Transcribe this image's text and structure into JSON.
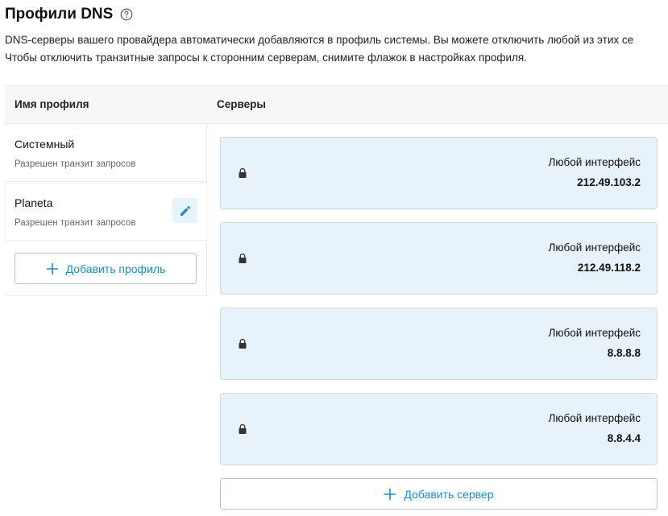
{
  "page": {
    "title": "Профили DNS",
    "description_line1": "DNS-серверы вашего провайдера автоматически добавляются в профиль системы. Вы можете отключить любой из этих се",
    "description_line2": "Чтобы отключить транзитные запросы к сторонним серверам, снимите флажок в настройках профиля."
  },
  "table": {
    "col_profile": "Имя профиля",
    "col_servers": "Серверы"
  },
  "profiles": [
    {
      "name": "Системный",
      "subtitle": "Разрешен транзит запросов"
    },
    {
      "name": "Planeta",
      "subtitle": "Разрешен транзит запросов"
    }
  ],
  "add_profile_label": "Добавить профиль",
  "servers": [
    {
      "interface": "Любой интерфейс",
      "ip": "212.49.103.2",
      "icon": "lock-icon"
    },
    {
      "interface": "Любой интерфейс",
      "ip": "212.49.118.2",
      "icon": "lock-icon"
    },
    {
      "interface": "Любой интерфейс",
      "ip": "8.8.8.8",
      "icon": "lock-icon"
    },
    {
      "interface": "Любой интерфейс",
      "ip": "8.8.4.4",
      "icon": "lock-icon"
    }
  ],
  "add_server_label": "Добавить сервер",
  "colors": {
    "accent": "#1a8cc8",
    "card_bg": "#e7f2fa",
    "edit_bg": "#e6f3fb"
  }
}
